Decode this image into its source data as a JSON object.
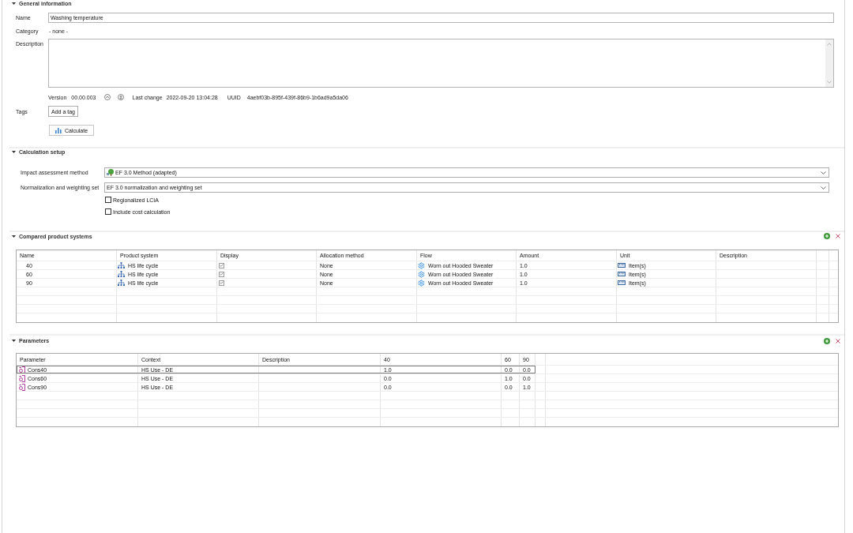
{
  "general_information": {
    "title": "General information",
    "expanded": true,
    "name": {
      "label": "Name",
      "value": "Washing temperature"
    },
    "category": {
      "label": "Category",
      "value": "- none -"
    },
    "description": {
      "label": "Description"
    },
    "version": {
      "label": "Version",
      "value": "00.00.003"
    },
    "last_change": {
      "label": "Last change",
      "value": "2022-09-20 13:04:28"
    },
    "uuid": {
      "label": "UUID",
      "value": "4aebf03b-895f-439f-86b9-1b6ad9a5da06"
    },
    "tags": {
      "label": "Tags",
      "button": "Add a tag"
    },
    "calculate_button": "Calculate"
  },
  "calculation_setup": {
    "title": "Calculation setup",
    "expanded": true,
    "impact_assessment_method": {
      "label": "Impact assessment method",
      "value": "EF 3.0 Method (adapted)"
    },
    "normalization_and_weighting_set": {
      "label": "Normalization and weighting set",
      "value": "EF 3.0 normalization and weighting set"
    },
    "options": [
      {
        "label": "Regionalized LCIA",
        "checked": false
      },
      {
        "label": "Include cost calculation",
        "checked": false
      }
    ]
  },
  "compared_product_systems": {
    "title": "Compared product systems",
    "expanded": true,
    "columns": [
      "Name",
      "Product system",
      "Display",
      "Allocation method",
      "Flow",
      "Amount",
      "Unit",
      "Description"
    ],
    "rows": [
      {
        "name": "40",
        "product_system": "HS life cycle",
        "display": true,
        "allocation_method": "None",
        "flow": "Worn out Hooded Sweater",
        "amount": "1.0",
        "unit": "Item(s)"
      },
      {
        "name": "60",
        "product_system": "HS life cycle",
        "display": true,
        "allocation_method": "None",
        "flow": "Worn out Hooded Sweater",
        "amount": "1.0",
        "unit": "Item(s)"
      },
      {
        "name": "90",
        "product_system": "HS life cycle",
        "display": true,
        "allocation_method": "None",
        "flow": "Worn out Hooded Sweater",
        "amount": "1.0",
        "unit": "Item(s)"
      }
    ]
  },
  "parameters": {
    "title": "Parameters",
    "expanded": true,
    "columns": [
      "Parameter",
      "Context",
      "Description",
      "40",
      "60",
      "90"
    ],
    "rows": [
      {
        "parameter": "Cons40",
        "context": "HS Use - DE",
        "values": [
          "1.0",
          "0.0",
          "0.0"
        ],
        "selected": true
      },
      {
        "parameter": "Cons60",
        "context": "HS Use - DE",
        "values": [
          "0.0",
          "1.0",
          "0.0"
        ],
        "selected": false
      },
      {
        "parameter": "Cons90",
        "context": "HS Use - DE",
        "values": [
          "0.0",
          "0.0",
          "1.0"
        ],
        "selected": false
      }
    ]
  }
}
